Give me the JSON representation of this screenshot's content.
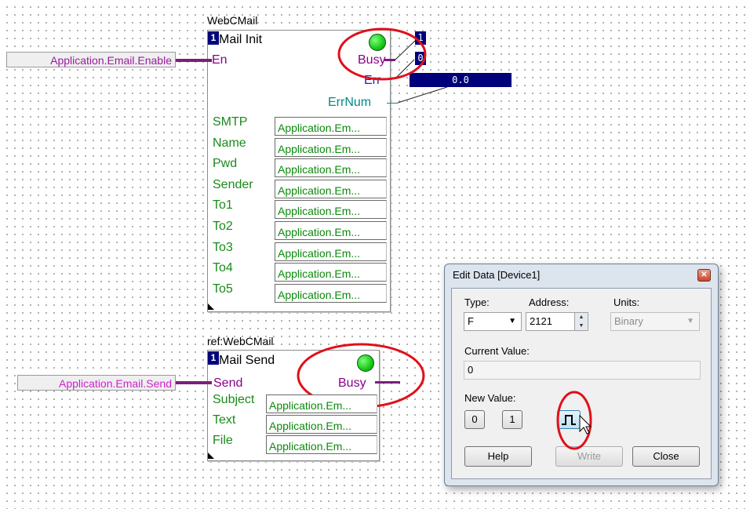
{
  "block1": {
    "title": "WebCMail",
    "index": "1",
    "name": "Mail Init",
    "input_label": "Application.Email.Enable",
    "pin_en": "En",
    "pin_busy": "Busy",
    "pin_err": "Err",
    "pin_errnum": "ErrNum",
    "busy_value": "1",
    "err_value": "0",
    "errnum_value": "0.0",
    "params": [
      {
        "name": "SMTP",
        "value": "Application.Em..."
      },
      {
        "name": "Name",
        "value": "Application.Em..."
      },
      {
        "name": "Pwd",
        "value": "Application.Em..."
      },
      {
        "name": "Sender",
        "value": "Application.Em..."
      },
      {
        "name": "To1",
        "value": "Application.Em..."
      },
      {
        "name": "To2",
        "value": "Application.Em..."
      },
      {
        "name": "To3",
        "value": "Application.Em..."
      },
      {
        "name": "To4",
        "value": "Application.Em..."
      },
      {
        "name": "To5",
        "value": "Application.Em..."
      }
    ]
  },
  "block2": {
    "title": "ref:WebCMail",
    "index": "1",
    "name": "Mail Send",
    "input_label": "Application.Email.Send",
    "pin_send": "Send",
    "pin_busy": "Busy",
    "params": [
      {
        "name": "Subject",
        "value": "Application.Em..."
      },
      {
        "name": "Text",
        "value": "Application.Em..."
      },
      {
        "name": "File",
        "value": "Application.Em..."
      }
    ]
  },
  "dialog": {
    "title": "Edit Data [Device1]",
    "type_label": "Type:",
    "type_value": "F",
    "address_label": "Address:",
    "address_value": "2121",
    "units_label": "Units:",
    "units_value": "Binary",
    "current_label": "Current Value:",
    "current_value": "0",
    "new_label": "New Value:",
    "btn_zero": "0",
    "btn_one": "1",
    "help": "Help",
    "write": "Write",
    "close": "Close"
  },
  "colors": {
    "annotation": "#e0101a",
    "wire": "#7a1f7a",
    "navy": "#00007a",
    "led": "#18c818"
  },
  "icons": {
    "pulse_button": "pulse-icon",
    "close": "close-icon",
    "dropdown": "chevron-down-icon",
    "spinner": "spin-arrows-icon"
  }
}
